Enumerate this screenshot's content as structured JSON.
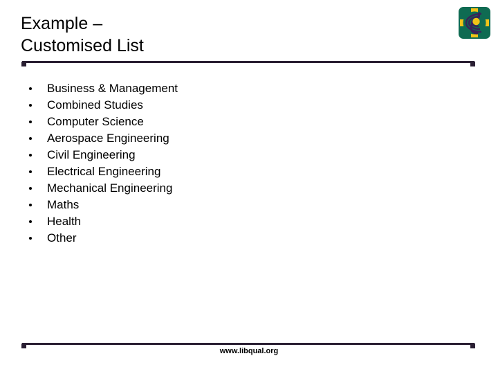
{
  "slide": {
    "title": {
      "line1": "Example –",
      "line2": "Customised List"
    },
    "list": {
      "items": [
        {
          "label": "Business & Management"
        },
        {
          "label": "Combined Studies"
        },
        {
          "label": "Computer Science"
        },
        {
          "label": "Aerospace Engineering"
        },
        {
          "label": "Civil Engineering"
        },
        {
          "label": "Electrical Engineering"
        },
        {
          "label": "Mechanical Engineering"
        },
        {
          "label": "Maths"
        },
        {
          "label": "Health"
        },
        {
          "label": "Other"
        }
      ]
    },
    "footer": {
      "url": "www.libqual.org"
    },
    "logo": {
      "name": "libqual-logo",
      "background_color": "#0f6b52",
      "accent_color": "#f2c318",
      "spiral_color": "#3b2259"
    },
    "colors": {
      "rule": "#2a1f33",
      "text": "#000000",
      "page_background": "#ffffff"
    }
  }
}
